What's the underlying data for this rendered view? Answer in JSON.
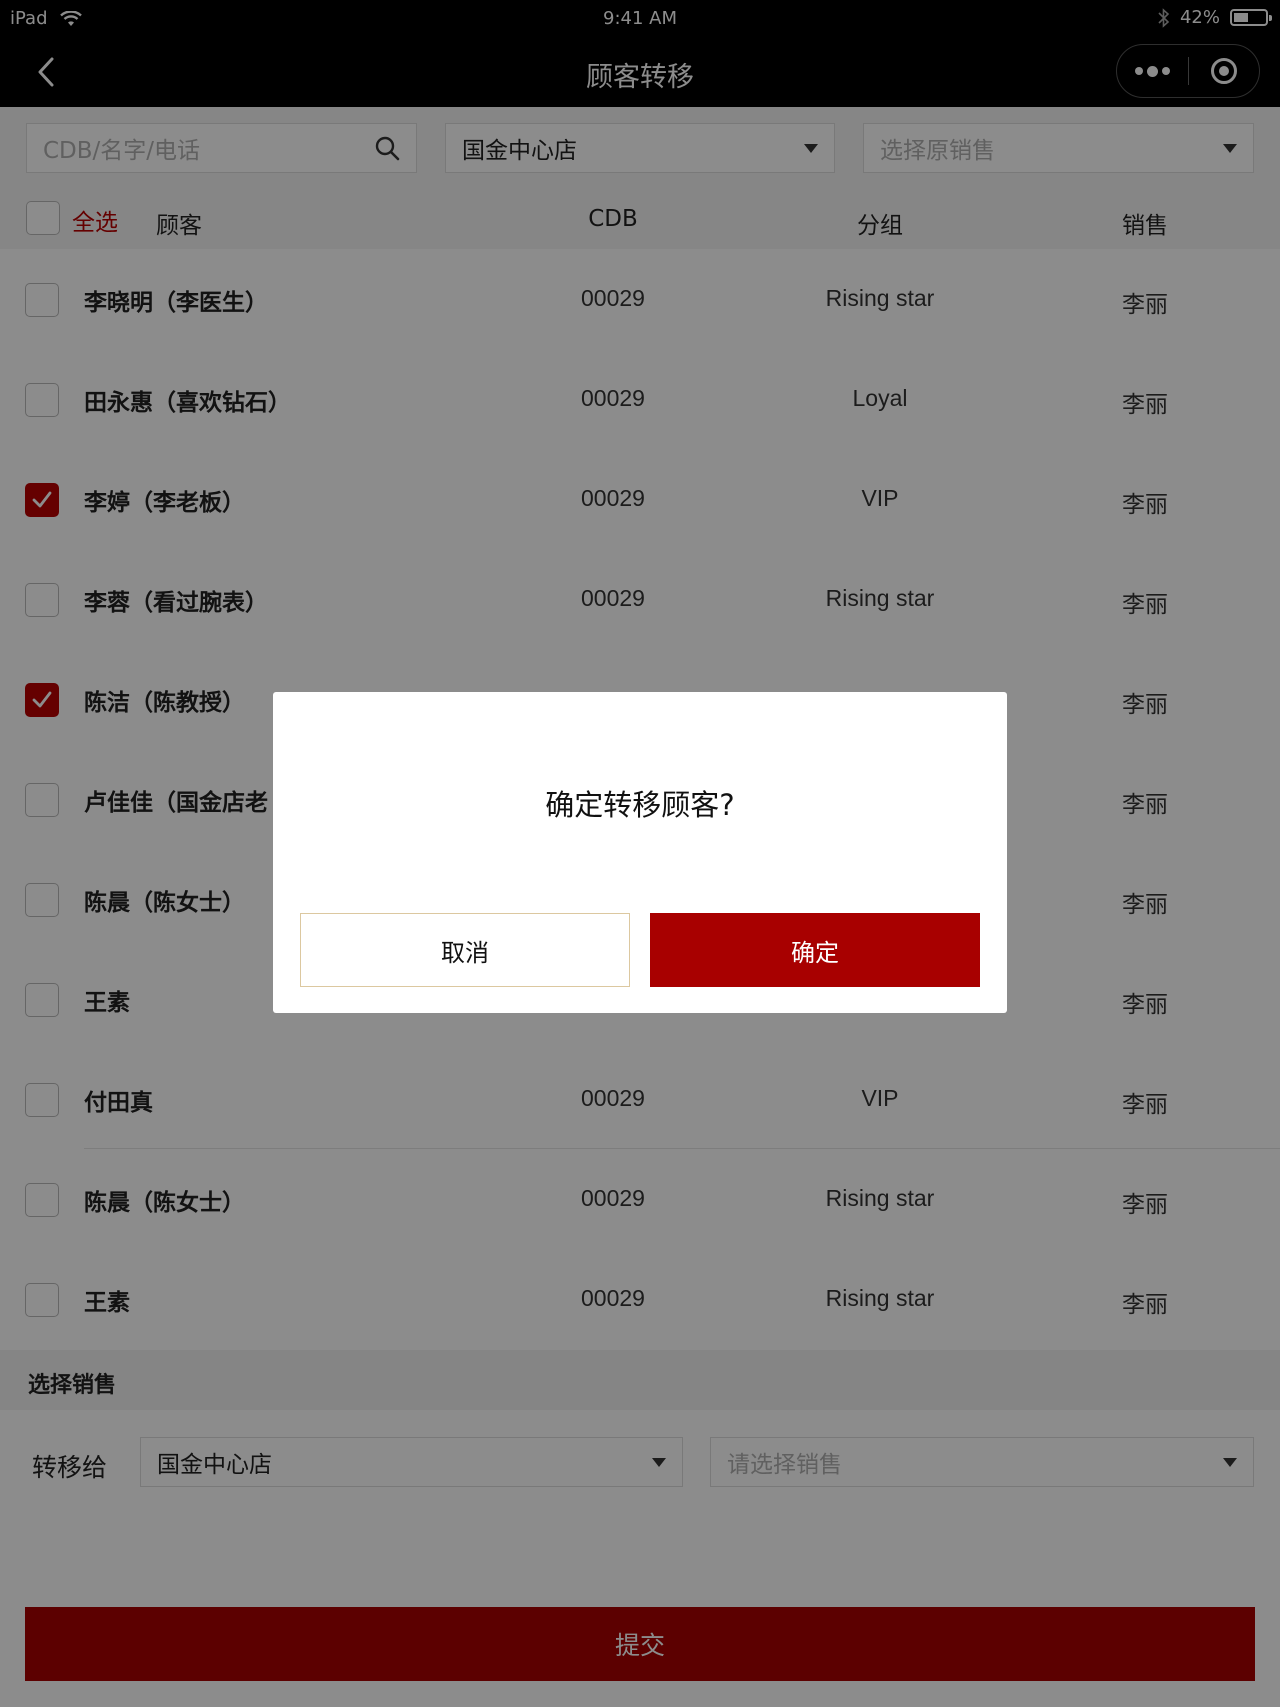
{
  "status_bar": {
    "device": "iPad",
    "time": "9:41 AM",
    "battery": "42%",
    "battery_level": 0.42
  },
  "nav": {
    "title": "顾客转移"
  },
  "filters": {
    "search_placeholder": "CDB/名字/电话",
    "store_value": "国金中心店",
    "sales_placeholder": "选择原销售"
  },
  "table": {
    "select_all": "全选",
    "columns": [
      "顾客",
      "CDB",
      "分组",
      "销售"
    ],
    "rows": [
      {
        "name": "李晓明（李医生）",
        "cdb": "00029",
        "group": "Rising star",
        "sales": "李丽",
        "checked": false
      },
      {
        "name": "田永惠（喜欢钻石）",
        "cdb": "00029",
        "group": "Loyal",
        "sales": "李丽",
        "checked": false
      },
      {
        "name": "李婷（李老板）",
        "cdb": "00029",
        "group": "VIP",
        "sales": "李丽",
        "checked": true
      },
      {
        "name": "李蓉（看过腕表）",
        "cdb": "00029",
        "group": "Rising star",
        "sales": "李丽",
        "checked": false
      },
      {
        "name": "陈洁（陈教授）",
        "cdb": "",
        "group": "",
        "sales": "李丽",
        "checked": true
      },
      {
        "name": "卢佳佳（国金店老",
        "cdb": "",
        "group": "",
        "sales": "李丽",
        "checked": false
      },
      {
        "name": "陈晨（陈女士）",
        "cdb": "",
        "group": "",
        "sales": "李丽",
        "checked": false
      },
      {
        "name": "王素",
        "cdb": "",
        "group": "",
        "sales": "李丽",
        "checked": false
      },
      {
        "name": "付田真",
        "cdb": "00029",
        "group": "VIP",
        "sales": "李丽",
        "checked": false
      },
      {
        "name": "陈晨（陈女士）",
        "cdb": "00029",
        "group": "Rising star",
        "sales": "李丽",
        "checked": false
      },
      {
        "name": "王素",
        "cdb": "00029",
        "group": "Rising star",
        "sales": "李丽",
        "checked": false
      }
    ]
  },
  "transfer": {
    "section_title": "选择销售",
    "label": "转移给",
    "store_value": "国金中心店",
    "sales_placeholder": "请选择销售"
  },
  "submit_label": "提交",
  "dialog": {
    "message": "确定转移顾客?",
    "cancel_label": "取消",
    "ok_label": "确定"
  },
  "colors": {
    "accent": "#a80000",
    "checkbox_checked": "#b80000",
    "nav_bg": "#000000"
  }
}
